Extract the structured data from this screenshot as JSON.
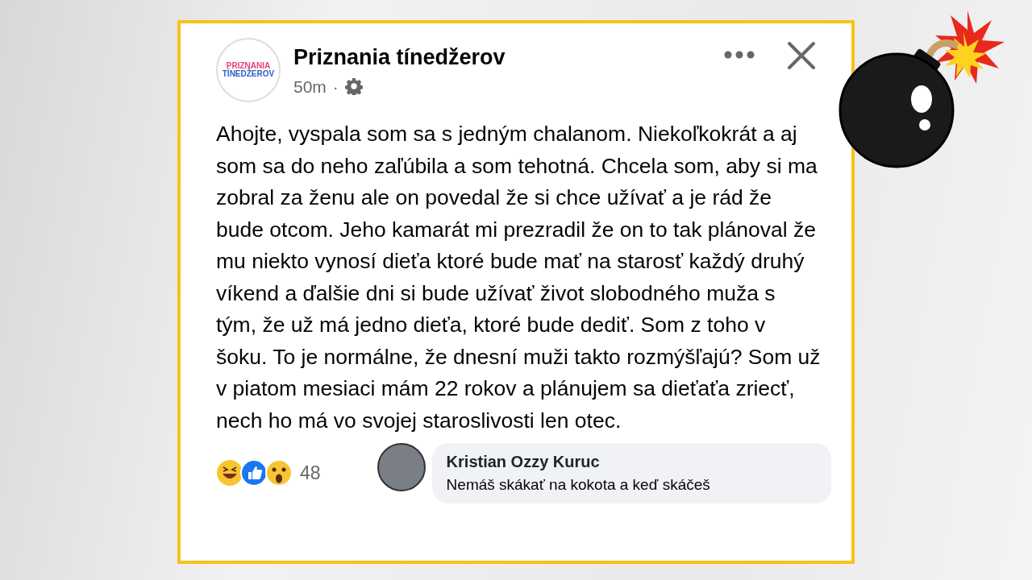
{
  "post": {
    "logo_text": [
      "PRIZNANIA",
      "TÍNEDŽEROV"
    ],
    "page_name": "Priznania tínedžerov",
    "time": "50m",
    "separator": "·",
    "text": "Ahojte, vyspala som sa s jedným chalanom. Niekoľkokrát a aj som sa do neho zaľúbila a som tehotná. Chcela som, aby si ma zobral za ženu ale on povedal že si chce užívať a je rád že bude otcom. Jeho kamarát mi prezradil že on to tak plánoval že mu niekto vynosí dieťa ktoré bude mať na starosť každý druhý víkend a ďalšie dni si bude užívať život slobodného muža s tým, že už má jedno dieťa, ktoré bude dediť. Som z toho v šoku. To je normálne, že dnesní muži takto rozmýšľajú? Som už v piatom mesiaci mám 22 rokov a plánujem sa dieťaťa zriecť, nech ho má vo svojej staroslivosti len otec.",
    "reaction_count": "48"
  },
  "comment": {
    "author": "Kristian Ozzy Kuruc",
    "text": "Nemáš skákať na kokota a keď skáčeš"
  }
}
